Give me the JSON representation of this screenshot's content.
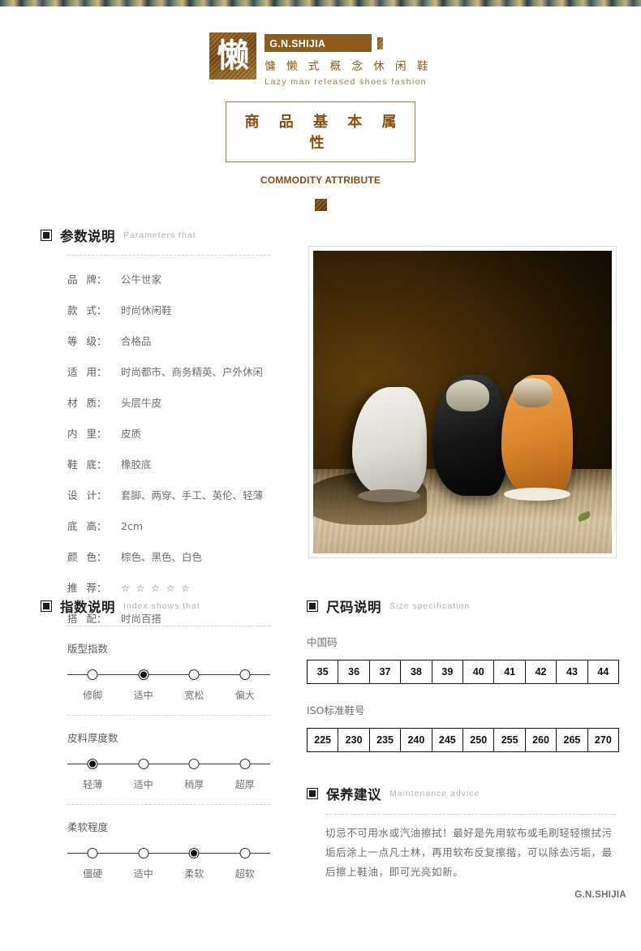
{
  "header": {
    "logo_glyph": "懒",
    "brand": "G.N.SHIJIA",
    "slogan_cn": "慵 懒 式 概 念 休 闲 鞋",
    "slogan_en": "Lazy  man  released  shoes  fashion",
    "attribute_box_title": "商 品 基 本 属 性",
    "attribute_box_en": "COMMODITY ATTRIBUTE"
  },
  "parameters": {
    "title_cn": "参数说明",
    "title_en": "Parameters  that",
    "rows": [
      {
        "label_a": "品",
        "label_b": "牌",
        "value": "公牛世家"
      },
      {
        "label_a": "款",
        "label_b": "式",
        "value": "时尚休闲鞋"
      },
      {
        "label_a": "等",
        "label_b": "级",
        "value": "合格品"
      },
      {
        "label_a": "适",
        "label_b": "用",
        "value": "时尚都市、商务精英、户外休闲"
      },
      {
        "label_a": "材",
        "label_b": "质",
        "value": "头层牛皮"
      },
      {
        "label_a": "内",
        "label_b": "里",
        "value": "皮质"
      },
      {
        "label_a": "鞋",
        "label_b": "底",
        "value": "橡胶底"
      },
      {
        "label_a": "设",
        "label_b": "计",
        "value": "套脚、两穿、手工、英伦、轻薄"
      },
      {
        "label_a": "底",
        "label_b": "高",
        "value": "2cm"
      },
      {
        "label_a": "颜",
        "label_b": "色",
        "value": "棕色、黑色、白色"
      },
      {
        "label_a": "推",
        "label_b": "荐",
        "value": "☆ ☆ ☆ ☆ ☆"
      },
      {
        "label_a": "搭",
        "label_b": "配",
        "value": "时尚百搭"
      }
    ]
  },
  "photo": {
    "alt": "three slip-on leather shoes on sand",
    "shoe_colors": [
      "#f4f2ee",
      "#141414",
      "#d9822a"
    ],
    "background_color": "#3a2506"
  },
  "index_section": {
    "title_cn": "指数说明",
    "title_en": "Index  shows  that",
    "sliders": [
      {
        "name": "版型指数",
        "options": [
          "修脚",
          "适中",
          "宽松",
          "偏大"
        ],
        "selected": 1
      },
      {
        "name": "皮料厚度数",
        "options": [
          "轻薄",
          "适中",
          "稍厚",
          "超厚"
        ],
        "selected": 0
      },
      {
        "name": "柔软程度",
        "options": [
          "僵硬",
          "适中",
          "柔软",
          "超软"
        ],
        "selected": 2
      }
    ]
  },
  "size_section": {
    "title_cn": "尺码说明",
    "title_en": "Size  specification",
    "tables": [
      {
        "label": "中国码",
        "values": [
          "35",
          "36",
          "37",
          "38",
          "39",
          "40",
          "41",
          "42",
          "43",
          "44"
        ]
      },
      {
        "label": "ISO标准鞋号",
        "values": [
          "225",
          "230",
          "235",
          "240",
          "245",
          "250",
          "255",
          "260",
          "265",
          "270"
        ]
      }
    ]
  },
  "maintenance": {
    "title_cn": "保养建议",
    "title_en": "Maintenance  advice",
    "text": "切忌不可用水或汽油擦拭！最好是先用软布或毛刷轻轻擦拭污垢后涂上一点凡士林，再用软布反复擦揩，可以除去污垢，最后擦上鞋油，即可光亮如新。"
  },
  "footer": {
    "brand": "G.N.SHIJIA"
  }
}
